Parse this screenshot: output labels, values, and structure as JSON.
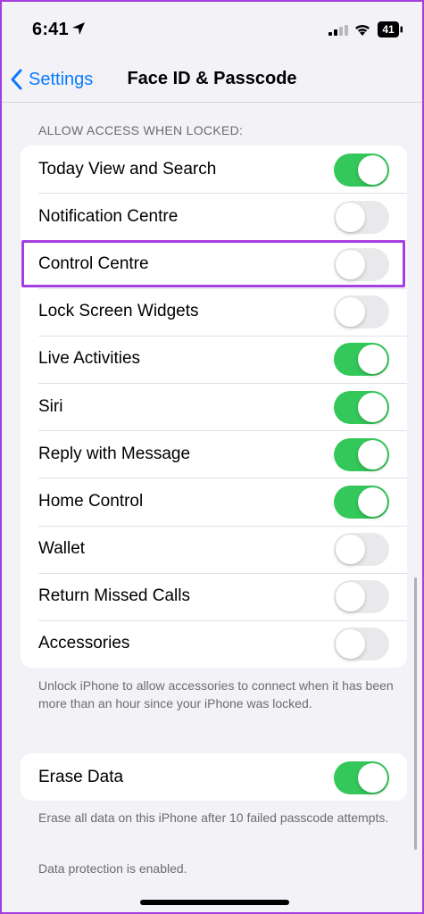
{
  "status_bar": {
    "time": "6:41",
    "battery": "41"
  },
  "nav": {
    "back_label": "Settings",
    "title": "Face ID & Passcode"
  },
  "section_header": "ALLOW ACCESS WHEN LOCKED:",
  "access_items": [
    {
      "label": "Today View and Search",
      "on": true
    },
    {
      "label": "Notification Centre",
      "on": false
    },
    {
      "label": "Control Centre",
      "on": false
    },
    {
      "label": "Lock Screen Widgets",
      "on": false
    },
    {
      "label": "Live Activities",
      "on": true
    },
    {
      "label": "Siri",
      "on": true
    },
    {
      "label": "Reply with Message",
      "on": true
    },
    {
      "label": "Home Control",
      "on": true
    },
    {
      "label": "Wallet",
      "on": false
    },
    {
      "label": "Return Missed Calls",
      "on": false
    },
    {
      "label": "Accessories",
      "on": false
    }
  ],
  "accessories_footnote": "Unlock iPhone to allow accessories to connect when it has been more than an hour since your iPhone was locked.",
  "erase_data": {
    "label": "Erase Data",
    "on": true
  },
  "erase_footnote": "Erase all data on this iPhone after 10 failed passcode attempts.",
  "protection_footnote": "Data protection is enabled.",
  "colors": {
    "accent": "#0a7aff",
    "toggle_on": "#34c759",
    "toggle_off": "#e9e9eb",
    "highlight": "#a43ee0"
  }
}
